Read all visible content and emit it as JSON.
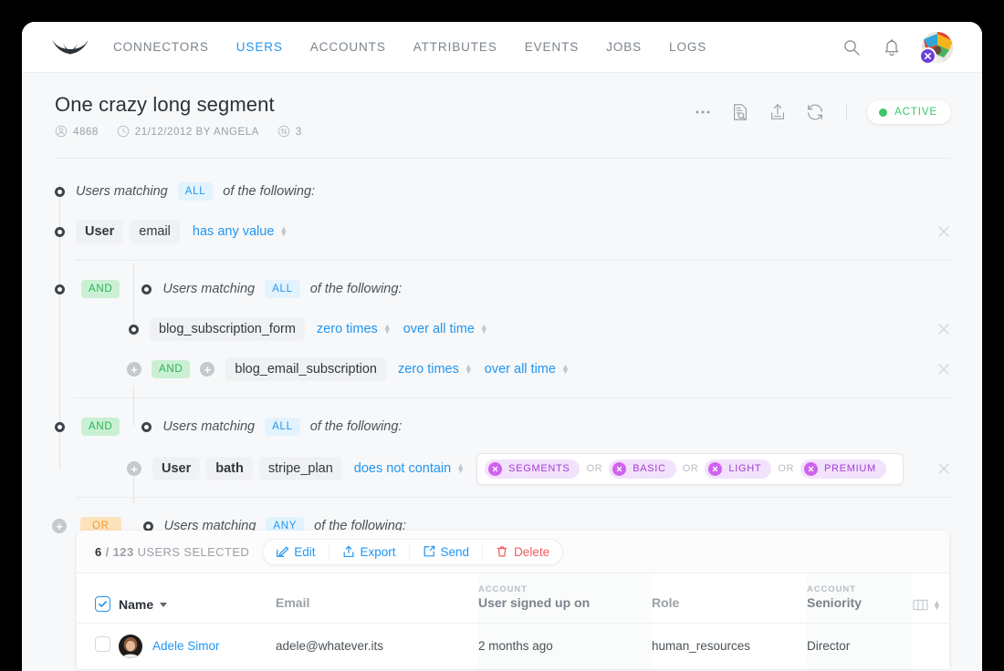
{
  "nav": {
    "logo_icon": "wing-logo",
    "links": [
      {
        "label": "CONNECTORS",
        "active": false
      },
      {
        "label": "USERS",
        "active": true
      },
      {
        "label": "ACCOUNTS",
        "active": false
      },
      {
        "label": "ATTRIBUTES",
        "active": false
      },
      {
        "label": "EVENTS",
        "active": false
      },
      {
        "label": "JOBS",
        "active": false
      },
      {
        "label": "LOGS",
        "active": false
      }
    ],
    "search_icon": "search-icon",
    "bell_icon": "bell-icon",
    "avatar_badge_icon": "close-x-icon"
  },
  "header": {
    "title": "One crazy long segment",
    "meta": [
      {
        "icon": "user-circle-icon",
        "text": "4868"
      },
      {
        "icon": "clock-icon",
        "text": "21/12/2012 BY ANGELA"
      },
      {
        "icon": "sync-arrows-icon",
        "text": "3"
      }
    ],
    "actions": [
      {
        "icon": "ellipsis-icon",
        "name": "more-options-button"
      },
      {
        "icon": "document-search-icon",
        "name": "preview-button"
      },
      {
        "icon": "upload-icon",
        "name": "export-button"
      },
      {
        "icon": "refresh-icon",
        "name": "refresh-button"
      }
    ],
    "status": {
      "label": "ACTIVE",
      "color": "#3ec46d"
    }
  },
  "builder": {
    "group1": {
      "prefix": "Users matching",
      "operator": "ALL",
      "suffix": "of the following:",
      "condition": {
        "entity": "User",
        "attribute": "email",
        "operator": "has any value"
      }
    },
    "group2": {
      "joiner": "AND",
      "prefix": "Users matching",
      "operator": "ALL",
      "suffix": "of the following:",
      "conditions": [
        {
          "event": "blog_subscription_form",
          "frequency": "zero times",
          "timeframe": "over all time"
        },
        {
          "joiner": "AND",
          "event": "blog_email_subscription",
          "frequency": "zero times",
          "timeframe": "over all time"
        }
      ]
    },
    "group3": {
      "joiner": "AND",
      "prefix": "Users matching",
      "operator": "ALL",
      "suffix": "of the following:",
      "condition": {
        "entity": "User",
        "scope": "bath",
        "attribute": "stripe_plan",
        "operator": "does not contain",
        "tags": [
          "SEGMENTS",
          "BASIC",
          "LIGHT",
          "PREMIUM"
        ],
        "tag_separator": "OR"
      }
    },
    "group4": {
      "joiner": "OR",
      "prefix": "Users matching",
      "operator": "ANY",
      "suffix": "of the following:"
    }
  },
  "table": {
    "toolbar": {
      "selected_count": "6",
      "total_count": "/ 123",
      "selected_label": "USERS SELECTED",
      "actions": [
        {
          "label": "Edit",
          "icon": "edit-icon",
          "danger": false
        },
        {
          "label": "Export",
          "icon": "upload-icon",
          "danger": false
        },
        {
          "label": "Send",
          "icon": "send-icon",
          "danger": false
        },
        {
          "label": "Delete",
          "icon": "trash-icon",
          "danger": true
        }
      ]
    },
    "columns": [
      {
        "group": "",
        "label": "Name",
        "sorted": true,
        "tint": false
      },
      {
        "group": "",
        "label": "Email",
        "sorted": false,
        "tint": false
      },
      {
        "group": "ACCOUNT",
        "label": "User signed up on",
        "sorted": false,
        "tint": true
      },
      {
        "group": "",
        "label": "Role",
        "sorted": false,
        "tint": false
      },
      {
        "group": "ACCOUNT",
        "label": "Seniority",
        "sorted": false,
        "tint": true
      }
    ],
    "column_options_icon": "columns-icon",
    "rows": [
      {
        "checked": false,
        "name": "Adele Simor",
        "email": "adele@whatever.its",
        "signed_up": "2 months ago",
        "role": "human_resources",
        "seniority": "Director"
      }
    ]
  }
}
